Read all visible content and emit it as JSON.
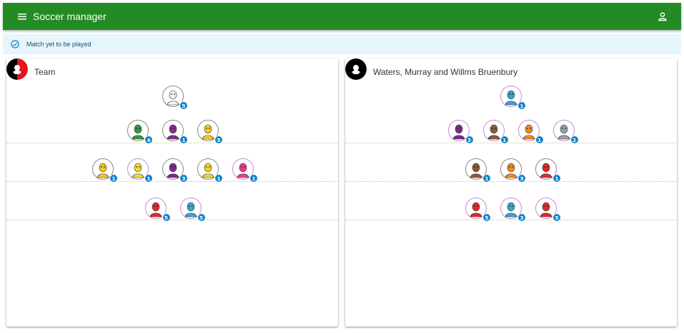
{
  "app": {
    "title": "Soccer manager"
  },
  "icons": {
    "menu": "hamburger-menu-icon",
    "account": "account-icon",
    "status": "check-circle-icon"
  },
  "alert": {
    "text": "Match yet to be played"
  },
  "colors": {
    "appbar": "#238b23",
    "alert_bg": "#e5f5fc",
    "badge": "#1683c6",
    "ring_purple": "#c48ad8",
    "ring_grey": "#888888"
  },
  "teams": [
    {
      "name": "Team",
      "crest": {
        "colors": [
          "#000000",
          "#e8141c"
        ]
      },
      "rows": [
        [
          {
            "level": "5",
            "color": "#f2f2f2",
            "ring": "grey"
          }
        ],
        [
          {
            "level": "4",
            "color": "#2e9c3c",
            "ring": "grey"
          },
          {
            "level": "1",
            "color": "#8a2a8c",
            "ring": "grey"
          },
          {
            "level": "5",
            "color": "#f2cc1c",
            "ring": "grey"
          }
        ],
        [
          {
            "level": "1",
            "color": "#f0c820",
            "ring": "grey"
          },
          {
            "level": "1",
            "color": "#f0dc30",
            "ring": "purple"
          },
          {
            "level": "3",
            "color": "#7c2a8a",
            "ring": "grey"
          },
          {
            "level": "1",
            "color": "#f0d420",
            "ring": "grey"
          },
          {
            "level": "1",
            "color": "#e83c8c",
            "ring": "purple"
          }
        ],
        [
          {
            "level": "5",
            "color": "#e02a2a",
            "ring": "purple"
          },
          {
            "level": "5",
            "color": "#3aa4d8",
            "ring": "purple"
          }
        ]
      ]
    },
    {
      "name": "Waters, Murray and Willms Bruenbury",
      "crest": {
        "colors": [
          "#000000",
          "#000000"
        ]
      },
      "rows": [
        [
          {
            "level": "1",
            "color": "#3aa0d8",
            "ring": "purple"
          }
        ],
        [
          {
            "level": "3",
            "color": "#7c2a8a",
            "ring": "purple"
          },
          {
            "level": "1",
            "color": "#8a5a3a",
            "ring": "purple"
          },
          {
            "level": "1",
            "color": "#f08c20",
            "ring": "purple"
          },
          {
            "level": "2",
            "color": "#9aa0a8",
            "ring": "purple"
          }
        ],
        [
          {
            "level": "1",
            "color": "#8a5a3a",
            "ring": "grey"
          },
          {
            "level": "3",
            "color": "#f08c20",
            "ring": "grey"
          },
          {
            "level": "1",
            "color": "#e02a2a",
            "ring": "grey"
          }
        ],
        [
          {
            "level": "5",
            "color": "#e02a2a",
            "ring": "purple"
          },
          {
            "level": "3",
            "color": "#3aa4d8",
            "ring": "purple"
          },
          {
            "level": "5",
            "color": "#e02a2a",
            "ring": "purple"
          }
        ]
      ]
    }
  ]
}
